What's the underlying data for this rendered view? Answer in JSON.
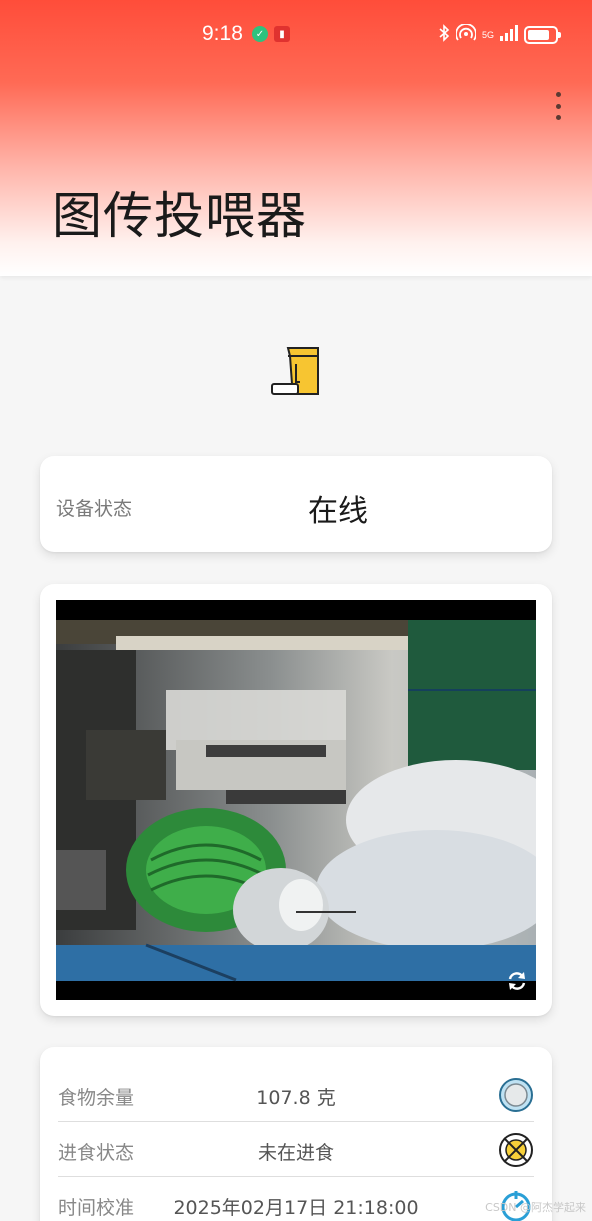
{
  "status_bar": {
    "time": "9:18",
    "network": "5G"
  },
  "app": {
    "title": "图传投喂器"
  },
  "device_status": {
    "label": "设备状态",
    "value": "在线"
  },
  "info": {
    "rows": [
      {
        "label": "食物余量",
        "value": "107.8 克",
        "icon": "plate-icon"
      },
      {
        "label": "进食状态",
        "value": "未在进食",
        "icon": "no-eating-icon"
      },
      {
        "label": "时间校准",
        "value": "2025年02月17日 21:18:00",
        "icon": "sync-time-icon"
      }
    ]
  },
  "watermark": "CSDN @阿杰学起来",
  "colors": {
    "header_top": "#ff4d3a",
    "accent_yellow": "#f7c531",
    "icon_blue": "#2a9fd6"
  }
}
